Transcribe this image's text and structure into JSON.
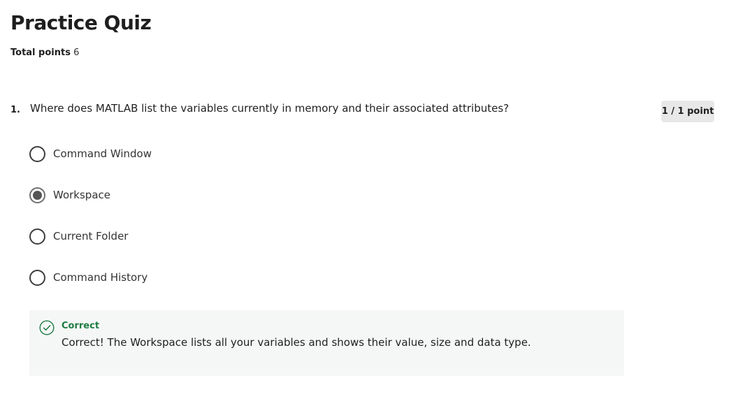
{
  "quiz": {
    "title": "Practice Quiz",
    "total_points_label": "Total points",
    "total_points_value": "6"
  },
  "question": {
    "number": "1.",
    "text": "Where does MATLAB list the variables currently in memory and their associated attributes?",
    "score": "1 / 1 point",
    "options": [
      {
        "label": "Command Window",
        "selected": false
      },
      {
        "label": "Workspace",
        "selected": true
      },
      {
        "label": "Current Folder",
        "selected": false
      },
      {
        "label": "Command History",
        "selected": false
      }
    ]
  },
  "feedback": {
    "status": "Correct",
    "message": "Correct! The Workspace lists all your variables and shows their value, size and data type.",
    "icon": "check-circle-icon",
    "accent_color": "#1e7c43"
  }
}
